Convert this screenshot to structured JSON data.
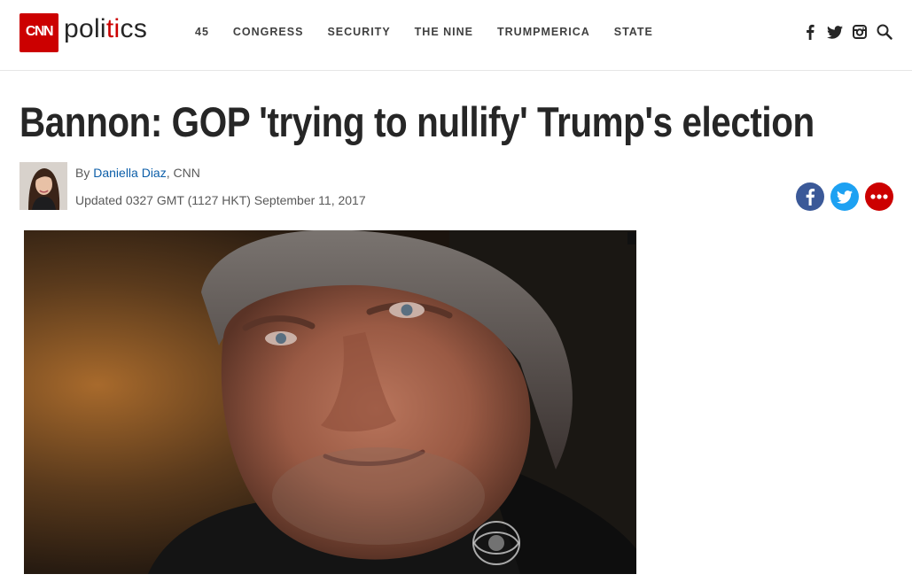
{
  "header": {
    "logo_text": "CNN",
    "section_pre": "poli",
    "section_mid": "ti",
    "section_post": "cs",
    "nav": [
      "45",
      "CONGRESS",
      "SECURITY",
      "THE NINE",
      "TRUMPMERICA",
      "STATE"
    ],
    "icons": [
      "facebook-icon",
      "twitter-icon",
      "instagram-icon",
      "search-icon"
    ]
  },
  "article": {
    "headline": "Bannon: GOP 'trying to nullify' Trump's election",
    "by_prefix": "By ",
    "author": "Daniella Diaz",
    "by_suffix": ", CNN",
    "updated": "Updated 0327 GMT (1127 HKT) September 11, 2017"
  },
  "share": {
    "buttons": [
      "facebook-share",
      "twitter-share",
      "more-share"
    ]
  },
  "colors": {
    "brand": "#cc0000",
    "facebook": "#3b5998",
    "twitter": "#1da1f2",
    "link": "#0c5ea8"
  }
}
